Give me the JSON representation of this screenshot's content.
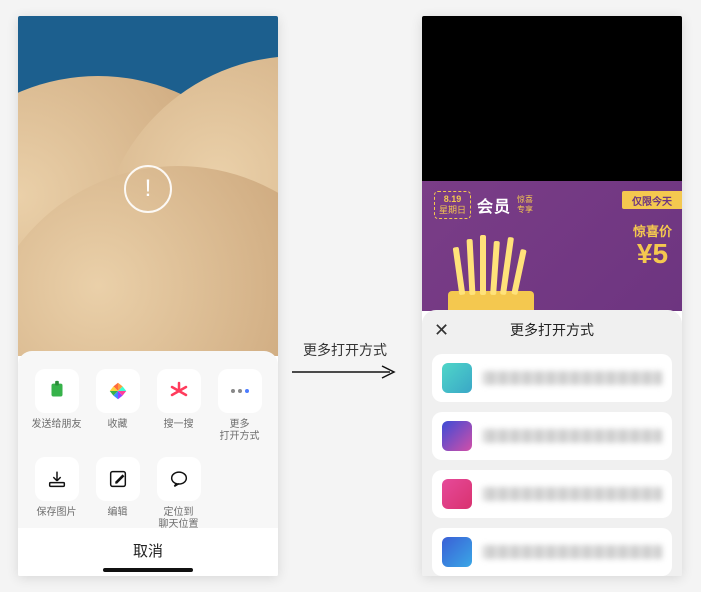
{
  "left": {
    "grid_row1": [
      {
        "label": "发送给朋友",
        "icon": "send-friend-icon",
        "color": "#36b24a"
      },
      {
        "label": "收藏",
        "icon": "favorite-icon",
        "color": "multi"
      },
      {
        "label": "搜一搜",
        "icon": "search-star-icon",
        "color": "#ff3b5c"
      },
      {
        "label": "更多\n打开方式",
        "icon": "more-icon",
        "color": "#777"
      }
    ],
    "grid_row2": [
      {
        "label": "保存图片",
        "icon": "download-icon"
      },
      {
        "label": "编辑",
        "icon": "edit-icon"
      },
      {
        "label": "定位到\n聊天位置",
        "icon": "locate-chat-icon"
      }
    ],
    "cancel_label": "取消"
  },
  "right": {
    "promo": {
      "date_top": "8.19",
      "date_bottom": "星期日",
      "title": "会员",
      "subtitle_a": "惊喜",
      "subtitle_b": "专享",
      "ribbon": "仅限今天",
      "price_label": "惊喜价",
      "price_value": "¥5"
    },
    "sheet_title": "更多打开方式",
    "apps": [
      "app-1",
      "app-2",
      "app-3",
      "app-4"
    ]
  },
  "arrow_label": "更多打开方式"
}
